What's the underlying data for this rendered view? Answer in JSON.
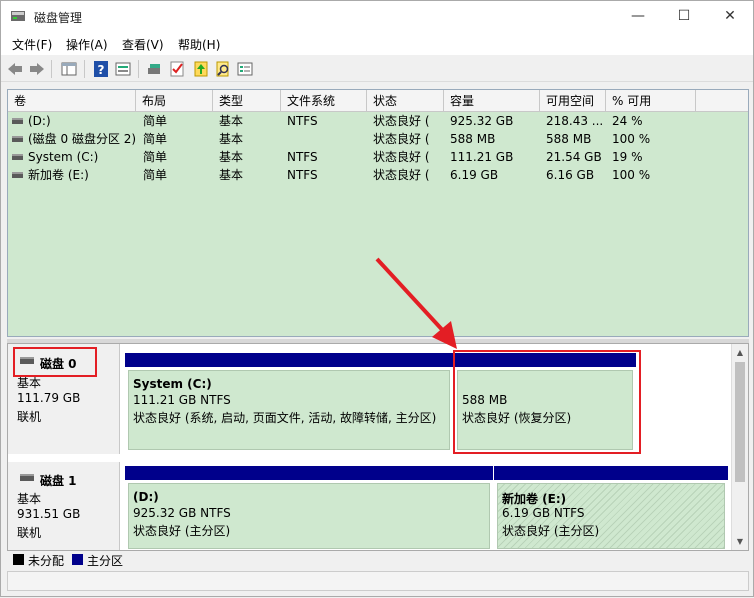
{
  "window": {
    "title": "磁盘管理",
    "minimize": "—",
    "maximize": "☐",
    "close": "✕"
  },
  "menu": [
    "文件(F)",
    "操作(A)",
    "查看(V)",
    "帮助(H)"
  ],
  "columns": [
    "卷",
    "布局",
    "类型",
    "文件系统",
    "状态",
    "容量",
    "可用空间",
    "% 可用"
  ],
  "volumes": [
    {
      "name": "(D:)",
      "layout": "简单",
      "type": "基本",
      "fs": "NTFS",
      "status": "状态良好 (",
      "capacity": "925.32 GB",
      "free": "218.43 ...",
      "pct": "24 %"
    },
    {
      "name": "(磁盘 0 磁盘分区 2)",
      "layout": "简单",
      "type": "基本",
      "fs": "",
      "status": "状态良好 (",
      "capacity": "588 MB",
      "free": "588 MB",
      "pct": "100 %"
    },
    {
      "name": "System (C:)",
      "layout": "简单",
      "type": "基本",
      "fs": "NTFS",
      "status": "状态良好 (",
      "capacity": "111.21 GB",
      "free": "21.54 GB",
      "pct": "19 %"
    },
    {
      "name": "新加卷 (E:)",
      "layout": "简单",
      "type": "基本",
      "fs": "NTFS",
      "status": "状态良好 (",
      "capacity": "6.19 GB",
      "free": "6.16 GB",
      "pct": "100 %"
    }
  ],
  "disks": [
    {
      "name": "磁盘 0",
      "type": "基本",
      "size": "111.79 GB",
      "state": "联机",
      "partitions": [
        {
          "name": "System  (C:)",
          "size": "111.21 GB NTFS",
          "status": "状态良好 (系统, 启动, 页面文件, 活动, 故障转储, 主分区)"
        },
        {
          "name": "",
          "size": "588 MB",
          "status": "状态良好 (恢复分区)"
        }
      ]
    },
    {
      "name": "磁盘 1",
      "type": "基本",
      "size": "931.51 GB",
      "state": "联机",
      "partitions": [
        {
          "name": "(D:)",
          "size": "925.32 GB NTFS",
          "status": "状态良好 (主分区)"
        },
        {
          "name": "新加卷  (E:)",
          "size": "6.19 GB NTFS",
          "status": "状态良好 (主分区)"
        }
      ]
    }
  ],
  "legend": [
    {
      "label": "未分配",
      "color": "#000000"
    },
    {
      "label": "主分区",
      "color": "#00008b"
    }
  ],
  "colors": {
    "highlight": "#e31e24",
    "partition_bar": "#00008b",
    "volume_bg": "#cfe8cf"
  }
}
